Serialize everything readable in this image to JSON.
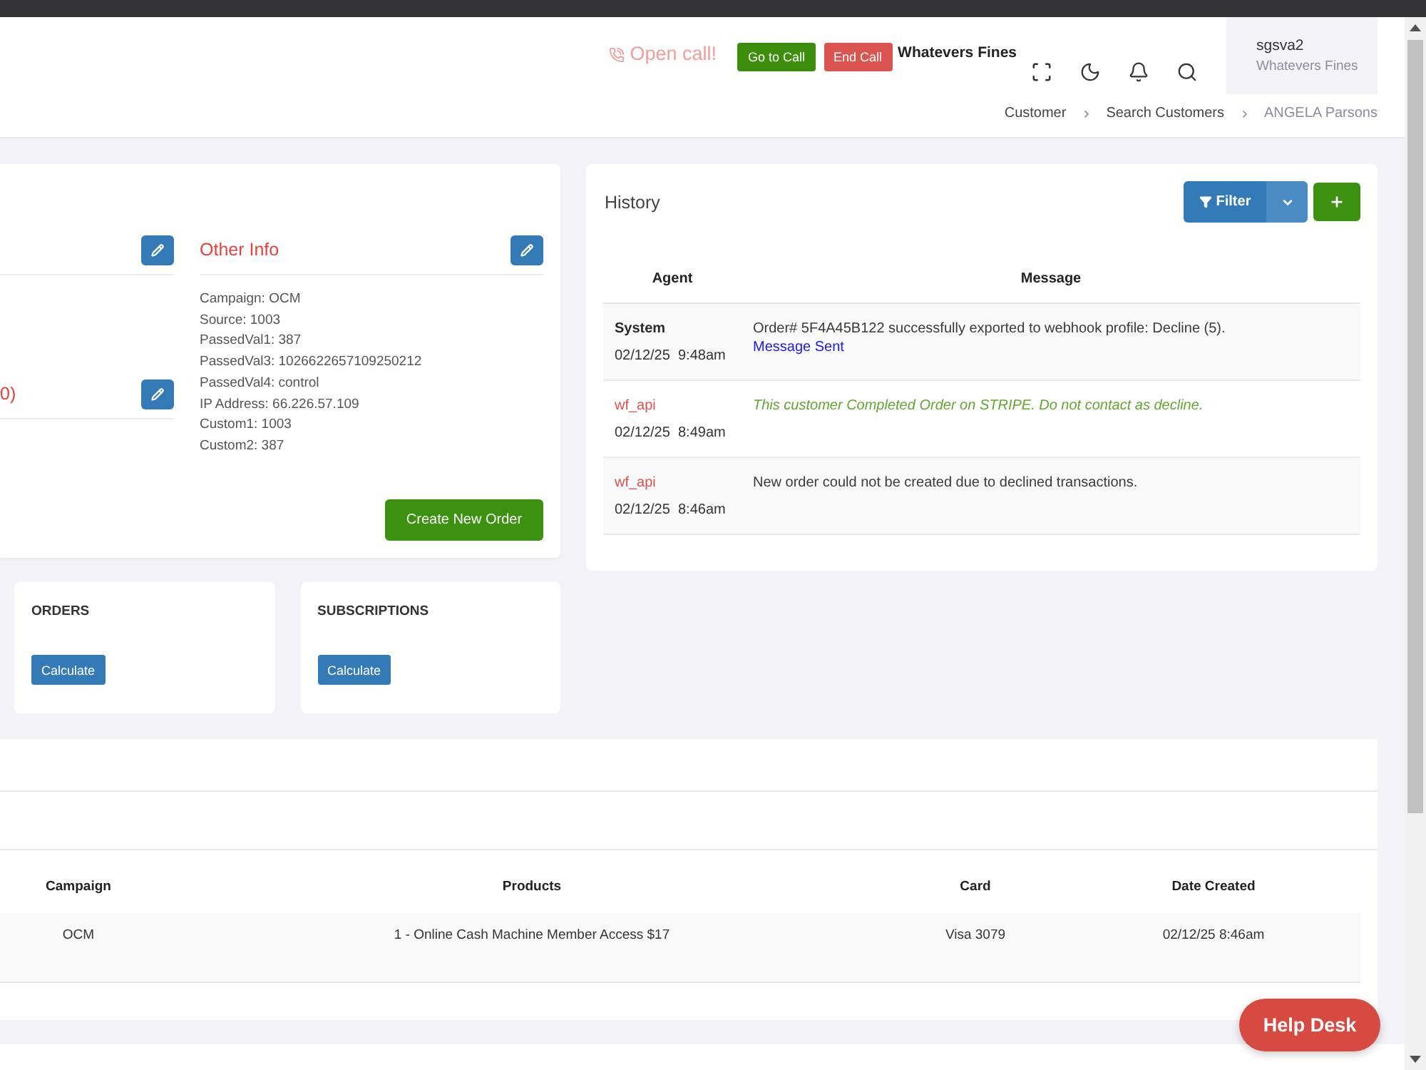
{
  "header": {
    "call_status": "Open call!",
    "call_buttons": [
      {
        "label": "Go to Call",
        "kind": "go"
      },
      {
        "label": "End Call",
        "kind": "end"
      }
    ],
    "company": "Whatevers Fines",
    "user": {
      "name": "sgsva2",
      "company": "Whatevers Fines"
    }
  },
  "breadcrumb": [
    {
      "label": "Customer",
      "current": false
    },
    {
      "label": "Search Customers",
      "current": false
    },
    {
      "label": "ANGELA Parsons",
      "current": true
    }
  ],
  "customer_card": {
    "sections": [
      {
        "kind": "untitled"
      },
      {
        "kind": "titled",
        "title": "0)"
      }
    ],
    "other_info": {
      "title": "Other Info",
      "lines": [
        "Campaign: OCM",
        "Source: 1003",
        "PassedVal1: 387",
        "PassedVal3: 1026622657109250212",
        "PassedVal4: control",
        "IP Address: 66.226.57.109",
        "Custom1: 1003",
        "Custom2: 387"
      ]
    },
    "create_button": "Create New Order"
  },
  "history": {
    "title": "History",
    "filter_label": "Filter",
    "columns": [
      "Agent",
      "Message"
    ],
    "rows": [
      {
        "kind": "system",
        "agent": "System",
        "time": "02/12/25  9:48am",
        "message": "Order# 5F4A45B122 successfully exported to webhook profile: Decline (5).",
        "link": "Message Sent"
      },
      {
        "kind": "note",
        "agent": "wf_api",
        "time": "02/12/25  8:49am",
        "message": "This customer Completed Order on STRIPE. Do not contact as decline."
      },
      {
        "kind": "api",
        "agent": "wf_api",
        "time": "02/12/25  8:46am",
        "message": "New order could not be created due to declined transactions."
      }
    ]
  },
  "stats": [
    {
      "title": "ORDERS",
      "button": "Calculate"
    },
    {
      "title": "SUBSCRIPTIONS",
      "button": "Calculate"
    }
  ],
  "orders_table": {
    "columns": [
      "Campaign",
      "Products",
      "Card",
      "Date Created"
    ],
    "rows": [
      [
        "OCM",
        "1 - Online Cash Machine Member Access $17",
        "Visa 3079",
        "02/12/25 8:46am"
      ]
    ]
  },
  "help_desk": "Help Desk"
}
